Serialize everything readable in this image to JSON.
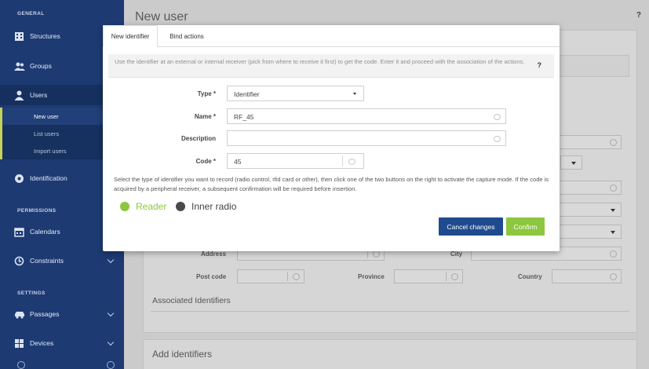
{
  "sidebar": {
    "sections": {
      "general": "GENERAL",
      "permissions": "PERMISSIONS",
      "settings": "SETTINGS"
    },
    "items": {
      "structures": "Structures",
      "groups": "Groups",
      "users": "Users",
      "identification": "Identification",
      "calendars": "Calendars",
      "constraints": "Constraints",
      "passages": "Passages",
      "devices": "Devices"
    },
    "users_sub": {
      "new_user": "New user",
      "list_users": "List users",
      "import_users": "Import users"
    }
  },
  "page": {
    "title": "New user",
    "help": "?",
    "labels": {
      "address": "Address",
      "city": "City",
      "post_code": "Post code",
      "province": "Province",
      "country": "Country"
    },
    "associated_identifiers": "Associated Identifiers",
    "add_identifiers": "Add identifiers"
  },
  "modal": {
    "tabs": {
      "new_identifier": "New identifier",
      "bind_actions": "Bind actions"
    },
    "info_text": "Use the identifier at an external or internal receiver (pick from where to receive it first) to get the code. Enter it and proceed with the association of the actions.",
    "info_help": "?",
    "fields": {
      "type": {
        "label": "Type *",
        "value": "Identifier"
      },
      "name": {
        "label": "Name *",
        "value": "RF_45"
      },
      "description": {
        "label": "Description",
        "value": ""
      },
      "code": {
        "label": "Code *",
        "value": "45"
      }
    },
    "note": "Select the type of identifier you want to record (radio control, rfid card or other), then click one of the two buttons on the right to activate the capture mode. If the code is acquired by a peripheral receiver, a subsequent confirmation will be required before insertion.",
    "radios": {
      "reader": "Reader",
      "inner_radio": "Inner radio"
    },
    "buttons": {
      "cancel": "Cancel changes",
      "confirm": "Confirm"
    }
  },
  "colors": {
    "sidebar": "#1d3a73",
    "accent_green": "#8dc63f",
    "cancel_button": "#1f4b8e",
    "radio_unselected": "#4a4a4a"
  }
}
